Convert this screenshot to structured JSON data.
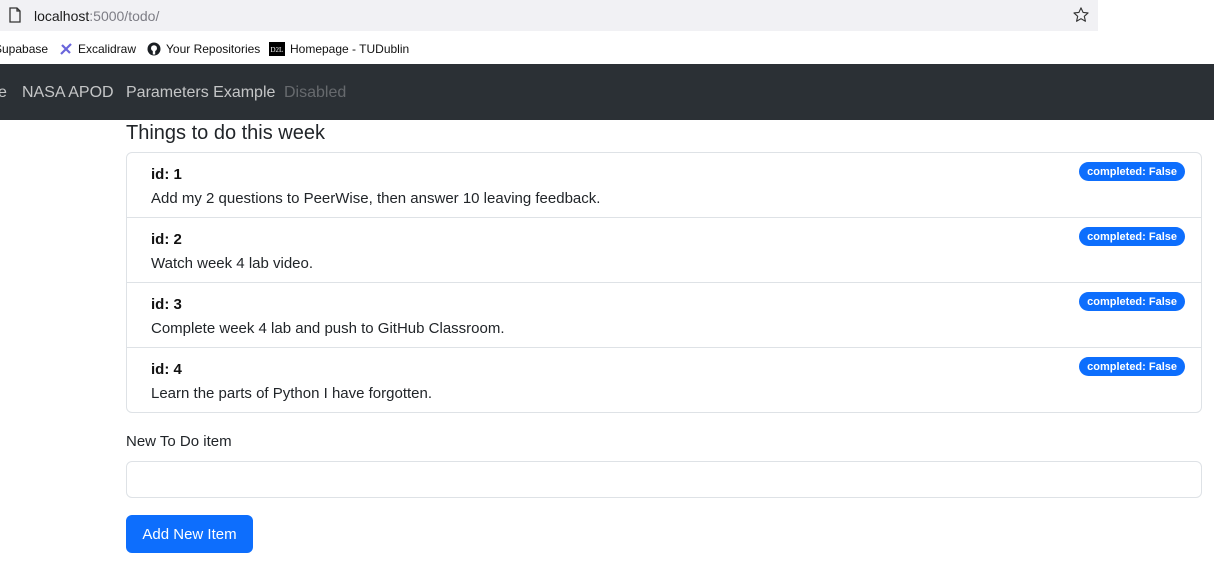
{
  "browser": {
    "url_host": "localhost",
    "url_path": ":5000/todo/"
  },
  "bookmarks": [
    {
      "label": "Supabase",
      "icon": "supabase-icon"
    },
    {
      "label": "Excalidraw",
      "icon": "excalidraw-icon"
    },
    {
      "label": "Your Repositories",
      "icon": "github-icon"
    },
    {
      "label": "Homepage - TUDublin",
      "icon": "d2l-icon"
    }
  ],
  "navbar": {
    "links": [
      "e",
      "NASA APOD",
      "Parameters Example",
      "Disabled"
    ]
  },
  "main": {
    "title": "Things to do this week",
    "todos": [
      {
        "id_label": "id: 1",
        "text": "Add my 2 questions to PeerWise, then answer 10 leaving feedback.",
        "badge": "completed: False"
      },
      {
        "id_label": "id: 2",
        "text": "Watch week 4 lab video.",
        "badge": "completed: False"
      },
      {
        "id_label": "id: 3",
        "text": "Complete week 4 lab and push to GitHub Classroom.",
        "badge": "completed: False"
      },
      {
        "id_label": "id: 4",
        "text": "Learn the parts of Python I have forgotten.",
        "badge": "completed: False"
      }
    ],
    "form": {
      "label": "New To Do item",
      "input_value": "",
      "button_label": "Add New Item"
    }
  },
  "colors": {
    "navbar_bg": "#2b3035",
    "primary": "#0d6efd"
  }
}
